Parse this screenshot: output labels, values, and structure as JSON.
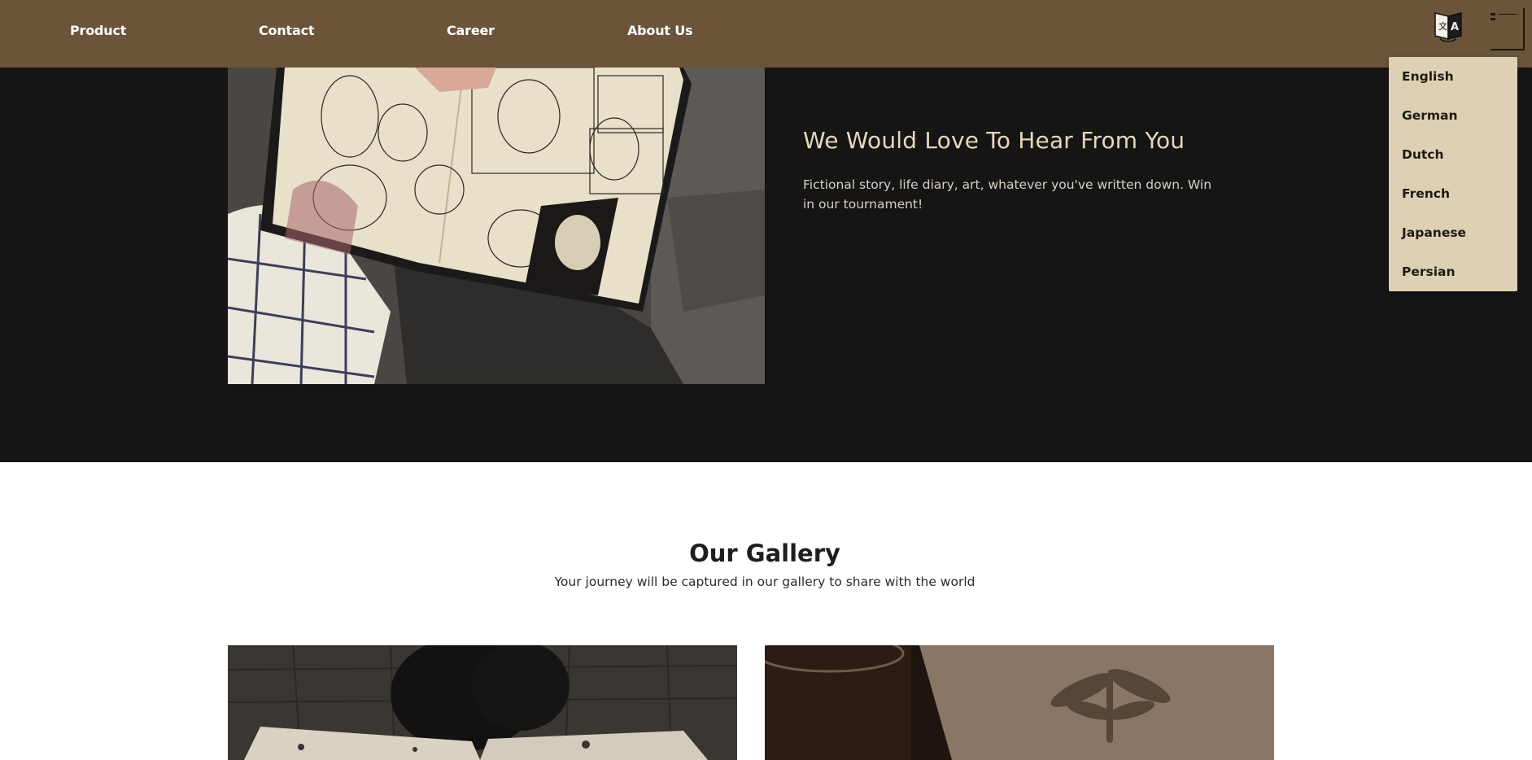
{
  "nav": {
    "links": [
      "Product",
      "Contact",
      "Career",
      "About Us"
    ],
    "language_icon": "translate-icon",
    "menu_icon": "hamburger-menu-icon"
  },
  "hero": {
    "title": "We Would Love To Hear From You",
    "text": "Fictional story, life diary, art, whatever you've written down. Win in our tournament!",
    "image": "sketchbook-photo"
  },
  "language_menu": {
    "options": [
      "English",
      "German",
      "Dutch",
      "French",
      "Japanese",
      "Persian"
    ]
  },
  "gallery": {
    "title": "Our Gallery",
    "subtitle": "Your journey will be captured in our gallery to share with the world",
    "images": [
      "open-sketchbook-photo",
      "moth-notebook-photo"
    ]
  },
  "colors": {
    "navbar": "#6b5439",
    "hero_background": "#151515",
    "dropdown_background": "#ddd0b4",
    "hero_title": "#e6d7bc"
  }
}
